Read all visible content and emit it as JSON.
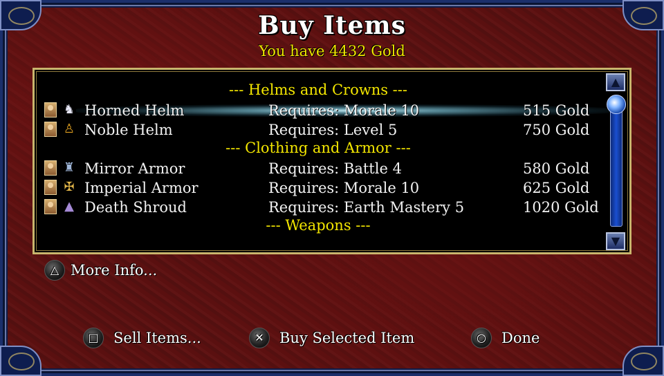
{
  "header": {
    "title": "Buy Items",
    "gold_text": "You have 4432 Gold"
  },
  "list": {
    "rows": [
      {
        "type": "category",
        "label": "--- Helms and Crowns ---"
      },
      {
        "type": "item",
        "icon": "horned-helm-icon",
        "glyph": "♞",
        "name": "Horned Helm",
        "requirement": "Requires: Morale 10",
        "price": "515 Gold",
        "selected": true
      },
      {
        "type": "item",
        "icon": "noble-helm-icon",
        "glyph": "♙",
        "name": "Noble Helm",
        "requirement": "Requires: Level 5",
        "price": "750 Gold",
        "selected": false
      },
      {
        "type": "category",
        "label": "--- Clothing and Armor ---"
      },
      {
        "type": "item",
        "icon": "mirror-armor-icon",
        "glyph": "♜",
        "name": "Mirror Armor",
        "requirement": "Requires: Battle 4",
        "price": "580 Gold",
        "selected": false
      },
      {
        "type": "item",
        "icon": "imperial-armor-icon",
        "glyph": "✠",
        "name": "Imperial Armor",
        "requirement": "Requires: Morale 10",
        "price": "625 Gold",
        "selected": false
      },
      {
        "type": "item",
        "icon": "death-shroud-icon",
        "glyph": "▲",
        "name": "Death Shroud",
        "requirement": "Requires: Earth Mastery 5",
        "price": "1020 Gold",
        "selected": false
      },
      {
        "type": "category",
        "label": "--- Weapons ---"
      }
    ]
  },
  "actions": {
    "more_info": {
      "glyph": "△",
      "label": "More Info..."
    },
    "sell": {
      "glyph": "□",
      "label": "Sell Items..."
    },
    "buy": {
      "glyph": "✕",
      "label": "Buy Selected Item"
    },
    "done": {
      "glyph": "○",
      "label": "Done"
    }
  },
  "colors": {
    "accent_yellow": "#f3e600",
    "frame_blue": "#1b2f6b",
    "background_red": "#561111"
  }
}
